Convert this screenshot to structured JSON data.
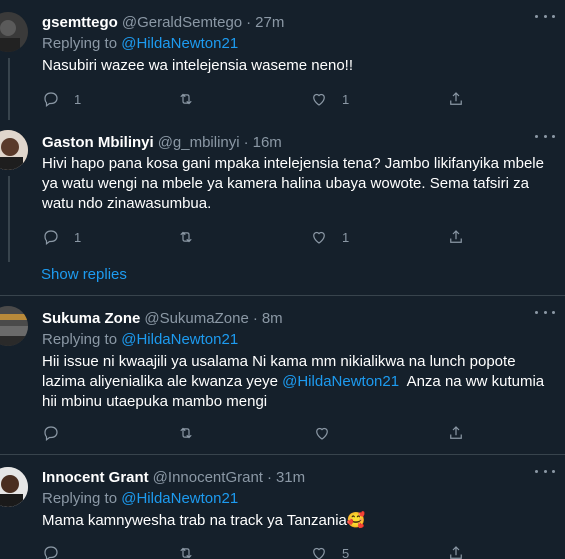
{
  "tweets": [
    {
      "name": "gsemttego",
      "handle": "@GeraldSemtego",
      "time": "27m",
      "replying_label": "Replying to",
      "replying_to": "@HildaNewton21",
      "text": "Nasubiri wazee wa intelejensia waseme neno!!",
      "reply_count": "1",
      "retweet_count": "",
      "like_count": "1"
    },
    {
      "name": "Gaston Mbilinyi",
      "handle": "@g_mbilinyi",
      "time": "16m",
      "text_lines": [
        "Hivi hapo pana kosa gani mpaka intelejensia tena? Jambo likifanyika mbele",
        "ya watu wengi na mbele ya kamera halina ubaya wowote. Sema tafsiri za",
        "watu ndo zinawasumbua."
      ],
      "reply_count": "1",
      "retweet_count": "",
      "like_count": "1",
      "show_replies": "Show replies"
    },
    {
      "name": "Sukuma Zone",
      "handle": "@SukumaZone",
      "time": "8m",
      "replying_label": "Replying to",
      "replying_to": "@HildaNewton21",
      "text_line1": "Hii issue ni kwaajili ya usalama Ni kama mm nikialikwa na lunch popote",
      "text_line2_a": "lazima aliyenialika ale kwanza yeye ",
      "text_line2_mention": "@HildaNewton21",
      "text_line2_b": "  Anza na ww kutumia",
      "text_line3": "hii mbinu utaepuka mambo mengi",
      "reply_count": "",
      "retweet_count": "",
      "like_count": ""
    },
    {
      "name": "Innocent Grant",
      "handle": "@InnocentGrant",
      "time": "31m",
      "replying_label": "Replying to",
      "replying_to": "@HildaNewton21",
      "text": "Mama kamnywesha trab na track ya Tanzania",
      "emoji": "🥰",
      "reply_count": "",
      "retweet_count": "",
      "like_count": "5"
    }
  ],
  "separator": "·",
  "icons": [
    "reply-icon",
    "retweet-icon",
    "like-icon",
    "share-icon",
    "more-icon"
  ],
  "colors": {
    "background": "#15202b",
    "accent": "#1d9bf0",
    "muted": "#8b98a5",
    "divider": "#38444d"
  }
}
